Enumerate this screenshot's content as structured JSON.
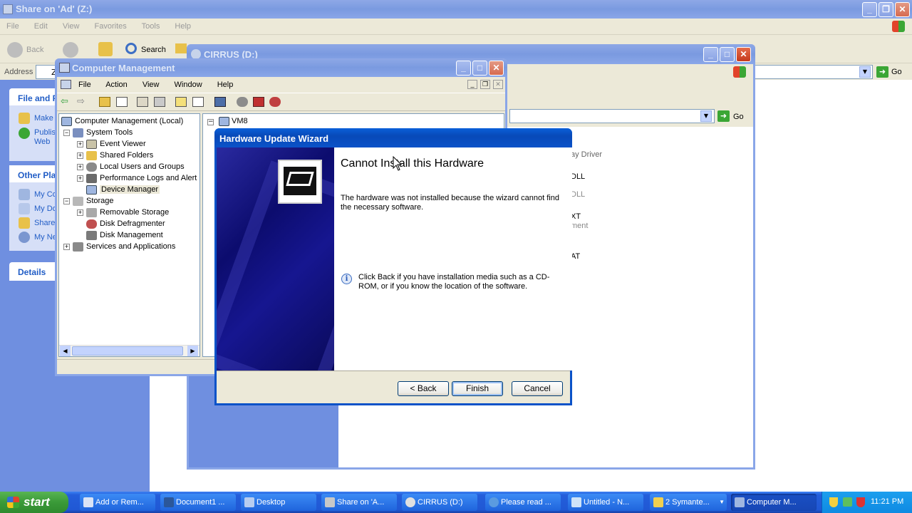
{
  "explorer": {
    "title": "Share on 'Ad' (Z:)",
    "menu": [
      "File",
      "Edit",
      "View",
      "Favorites",
      "Tools",
      "Help"
    ],
    "back_label": "Back",
    "search_label": "Search",
    "address_label": "Address",
    "address_value": "Z",
    "go_label": "Go",
    "panel_file": "File and F",
    "panel_file_items": [
      "Make",
      "Publis",
      "Web"
    ],
    "panel_other": "Other Pla",
    "panel_other_items": [
      "My Co",
      "My Do",
      "Share",
      "My Ne"
    ],
    "panel_details": "Details"
  },
  "cirrus": {
    "title": "CIRRUS (D:)",
    "go_label": "Go",
    "right_items": [
      "ay Driver",
      "DLL",
      "DLL",
      "XT",
      "ment",
      "AT"
    ]
  },
  "compmgmt": {
    "title": "Computer Management",
    "menu": [
      "File",
      "Action",
      "View",
      "Window",
      "Help"
    ],
    "right_header": "VM8",
    "tree": {
      "root": "Computer Management (Local)",
      "system_tools": "System Tools",
      "event_viewer": "Event Viewer",
      "shared_folders": "Shared Folders",
      "local_users": "Local Users and Groups",
      "perf_logs": "Performance Logs and Alert",
      "device_manager": "Device Manager",
      "storage": "Storage",
      "removable": "Removable Storage",
      "defrag": "Disk Defragmenter",
      "diskmgmt": "Disk Management",
      "services": "Services and Applications"
    }
  },
  "wizard": {
    "title": "Hardware Update Wizard",
    "heading": "Cannot Install this Hardware",
    "message": "The hardware was not installed because the wizard cannot find the necessary software.",
    "hint": "Click Back if you have installation media such as a CD-ROM, or if you know the location of the software.",
    "back_label": "< Back",
    "finish_label": "Finish",
    "cancel_label": "Cancel"
  },
  "taskbar": {
    "start_label": "start",
    "tasks": [
      "Add or Rem...",
      "Document1 ...",
      "Desktop",
      "Share on 'A...",
      "CIRRUS (D:)",
      "Please read ...",
      "Untitled - N...",
      "2 Symante...",
      "Computer M..."
    ],
    "clock": "11:21 PM"
  },
  "colors": {
    "xp_blue": "#0a52c8",
    "sidebar_blue": "#6f8fe0",
    "taskbar_blue": "#245edb",
    "start_green": "#3a9a38",
    "wizard_dark": "#0c0c6e"
  }
}
